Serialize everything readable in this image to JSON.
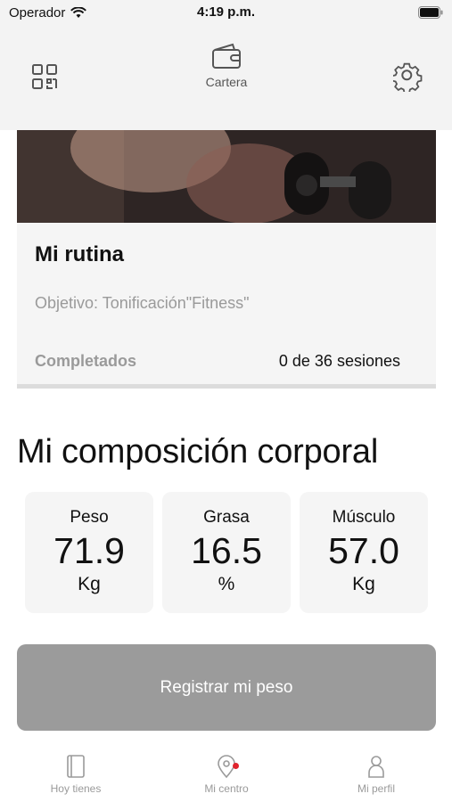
{
  "status_bar": {
    "carrier": "Operador",
    "time": "4:19 p.m."
  },
  "header": {
    "qr_icon": "qr-code-icon",
    "wallet_icon": "wallet-icon",
    "wallet_label": "Cartera",
    "settings_icon": "gear-icon"
  },
  "routine_card": {
    "title": "Mi rutina",
    "goal": "Objetivo: Tonificación\"Fitness\"",
    "completed_label": "Completados",
    "completed_value": "0 de 36 sesiones"
  },
  "body_composition": {
    "title": "Mi composición corporal",
    "metrics": [
      {
        "label": "Peso",
        "value": "71.9",
        "unit": "Kg"
      },
      {
        "label": "Grasa",
        "value": "16.5",
        "unit": "%"
      },
      {
        "label": "Músculo",
        "value": "57.0",
        "unit": "Kg"
      }
    ]
  },
  "register_button": "Registrar mi peso",
  "tab_bar": {
    "items": [
      {
        "label": "Hoy tienes",
        "icon": "book-icon"
      },
      {
        "label": "Mi centro",
        "icon": "location-pin-icon",
        "badge": true
      },
      {
        "label": "Mi perfil",
        "icon": "person-icon"
      }
    ]
  },
  "colors": {
    "header_bg": "#f3f3f3",
    "card_bg": "#f5f5f5",
    "button_bg": "#9b9b9b",
    "badge": "#e0242e",
    "muted_text": "#9a9a9a"
  }
}
